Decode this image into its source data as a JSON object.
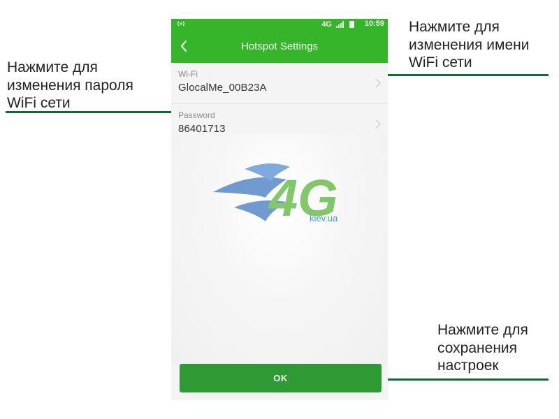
{
  "annotations": {
    "password_lines": [
      "Нажмите для",
      "изменения пароля",
      "WiFi сети"
    ],
    "wifi_lines": [
      "Нажмите для",
      "изменения имени",
      "WiFi сети"
    ],
    "save_lines": [
      "Нажмите для",
      "сохранения",
      "настроек"
    ]
  },
  "phone": {
    "status_bar": {
      "network": "4G",
      "time": "10:59"
    },
    "title": "Hotspot Settings",
    "wifi": {
      "label": "Wi-Fi",
      "value": "GlocalMe_00B23A"
    },
    "password": {
      "label": "Password",
      "value": "86401713"
    },
    "watermark": {
      "logo_text": "4G",
      "sub_text": "kiev.ua"
    },
    "ok_label": "OK"
  },
  "colors": {
    "header_green": "#36b52a",
    "button_green": "#2f9a34",
    "annotation_line": "#0f6a35"
  },
  "icons": [
    "back-arrow-icon",
    "chevron-right-icon",
    "signal-icon",
    "battery-icon",
    "hotspot-icon"
  ]
}
